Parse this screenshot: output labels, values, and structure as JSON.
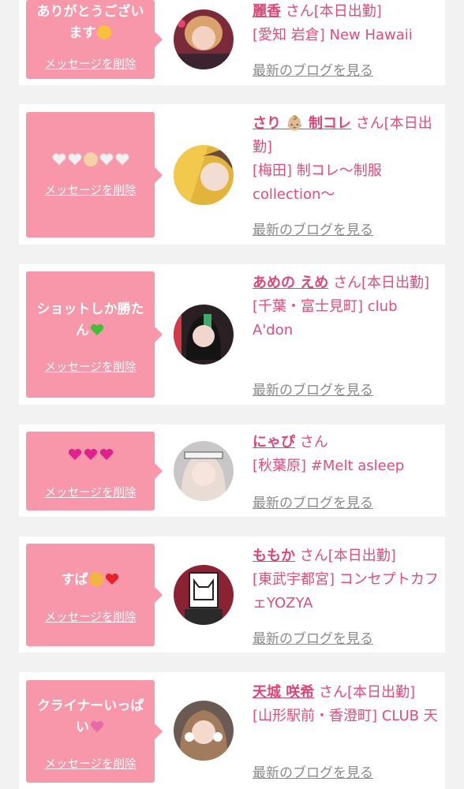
{
  "delete_label": "メッセージを削除",
  "blog_link_label": "最新のブログを見る",
  "cards": [
    {
      "message": "ありがとうございます",
      "name": "麗香",
      "suffix": "さん[本日出勤]",
      "shop": "[愛知 岩倉] New Hawaii",
      "emoji": [
        "smiling-face"
      ]
    },
    {
      "message": "",
      "name": "さり 👶🏼 制コレ",
      "suffix": "さん[本日出勤]",
      "shop": "[梅田] 制コレ〜制服collection〜",
      "emoji": [
        "white-heart",
        "white-heart",
        "baby",
        "white-heart",
        "white-heart"
      ]
    },
    {
      "message": "ショットしか勝たん",
      "name": "あめの えめ",
      "suffix": "さん[本日出勤]",
      "shop": "[千葉・富士見町] club A'don",
      "emoji": [
        "green-heart"
      ]
    },
    {
      "message": "",
      "name": "にゃぴ",
      "suffix": "さん",
      "shop": "[秋葉原] #Melt asleep",
      "emoji": [
        "pink-heart",
        "pink-heart",
        "pink-heart"
      ]
    },
    {
      "message": "すぱ",
      "name": "ももか",
      "suffix": "さん[本日出勤]",
      "shop": "[東武宇都宮] コンセプトカフェYOZYA",
      "emoji": [
        "smirk-cat",
        "red-heart"
      ]
    },
    {
      "message": "クライナーいっぱい",
      "name": "天城 咲希",
      "suffix": "さん[本日出勤]",
      "shop": "[山形駅前・香澄町] CLUB 天",
      "emoji": [
        "sparkling-heart"
      ]
    }
  ],
  "colors": {
    "bubble": "#f896aa",
    "name": "#e24575",
    "link": "#8a8a8a",
    "background": "#f2f2f2"
  }
}
